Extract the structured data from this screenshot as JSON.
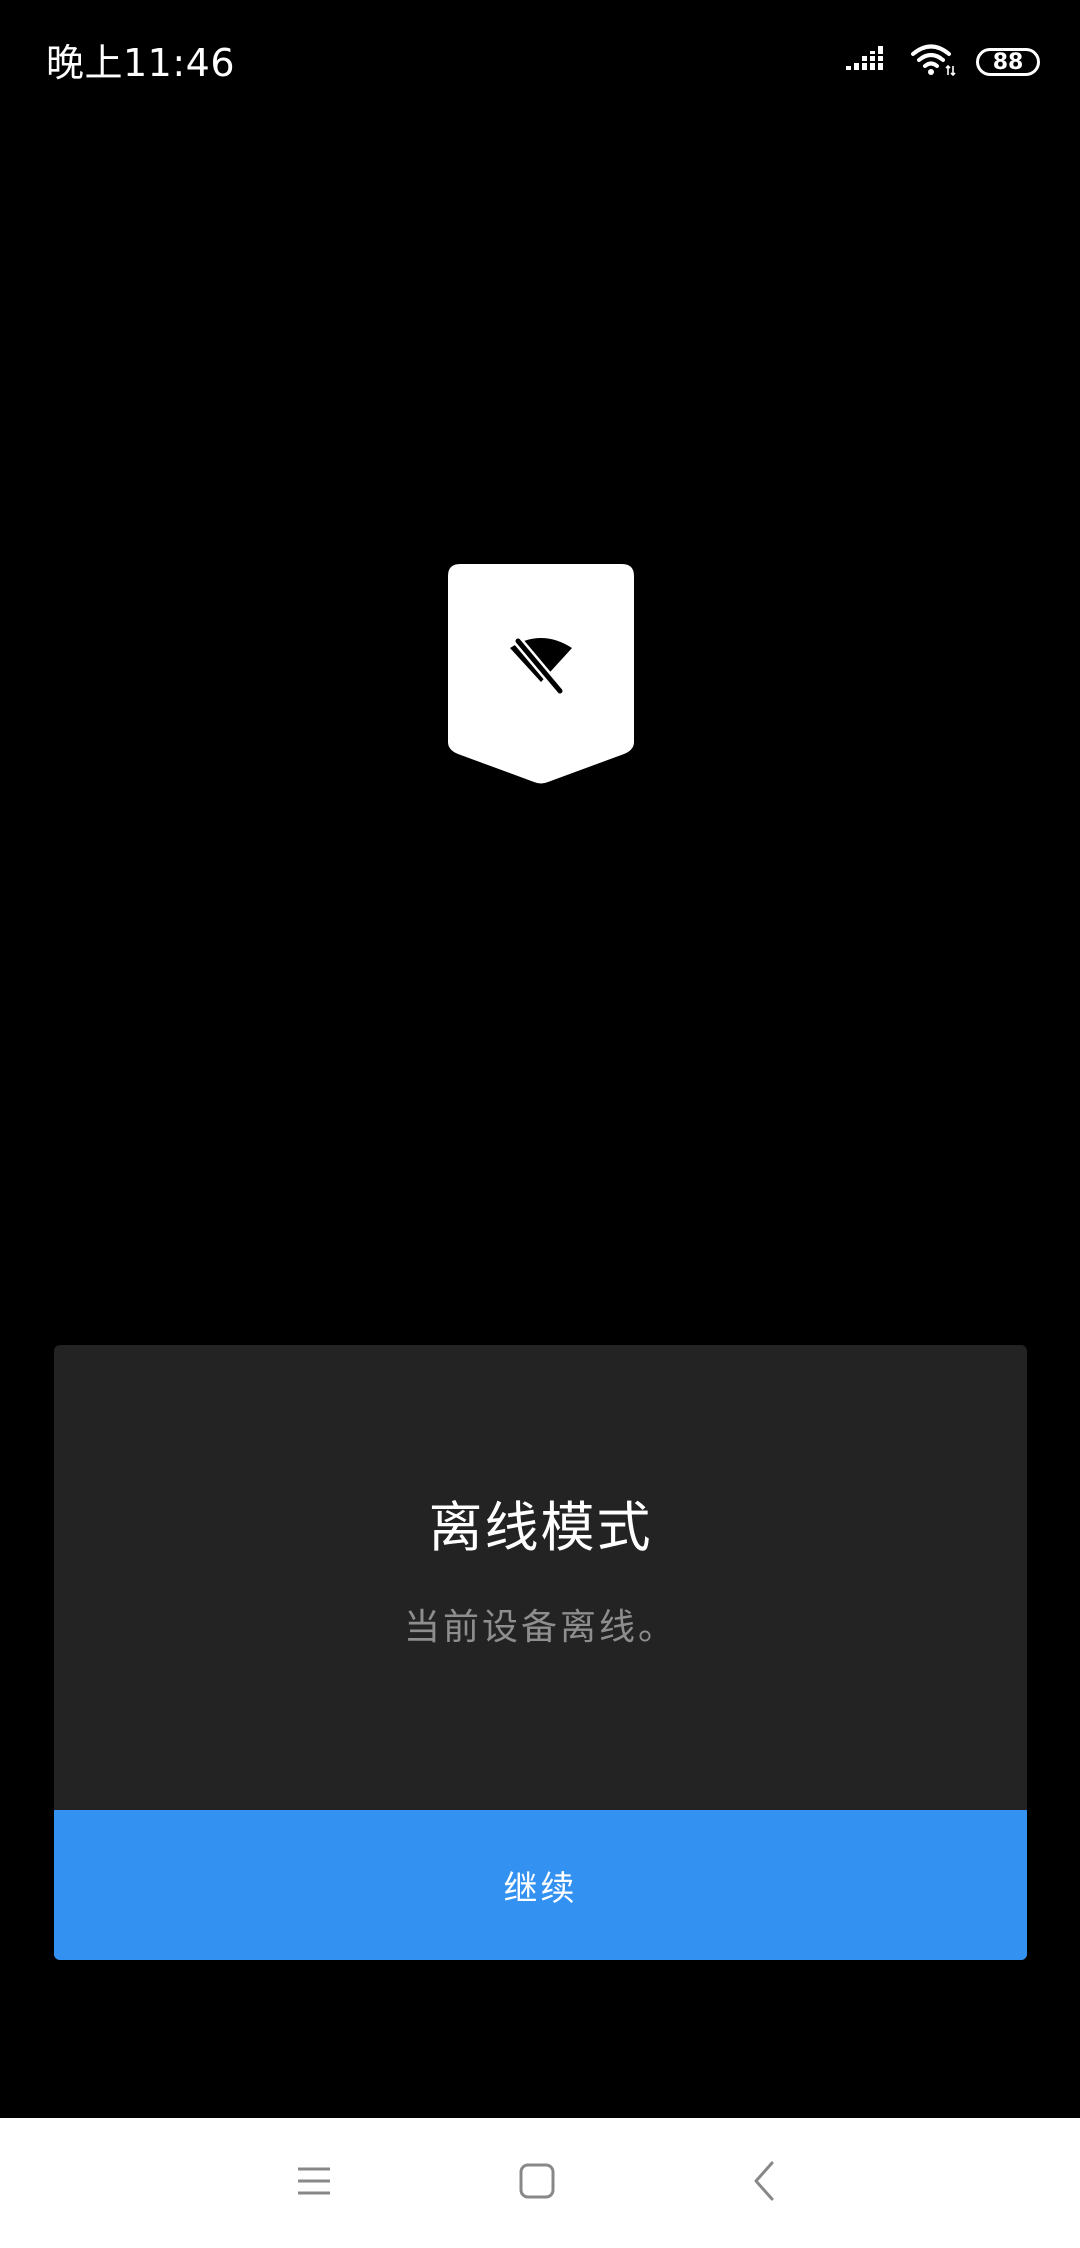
{
  "status_bar": {
    "time": "晚上11:46",
    "battery": "88",
    "icons": [
      "signal-icon",
      "wifi-icon",
      "battery-icon"
    ]
  },
  "logo": {
    "icon": "wifi-off-icon"
  },
  "dialog": {
    "title": "离线模式",
    "message": "当前设备离线。",
    "continue_label": "继续",
    "accent_color": "#3391f2"
  },
  "nav_bar": {
    "items": [
      "menu-icon",
      "home-icon",
      "back-icon"
    ]
  }
}
